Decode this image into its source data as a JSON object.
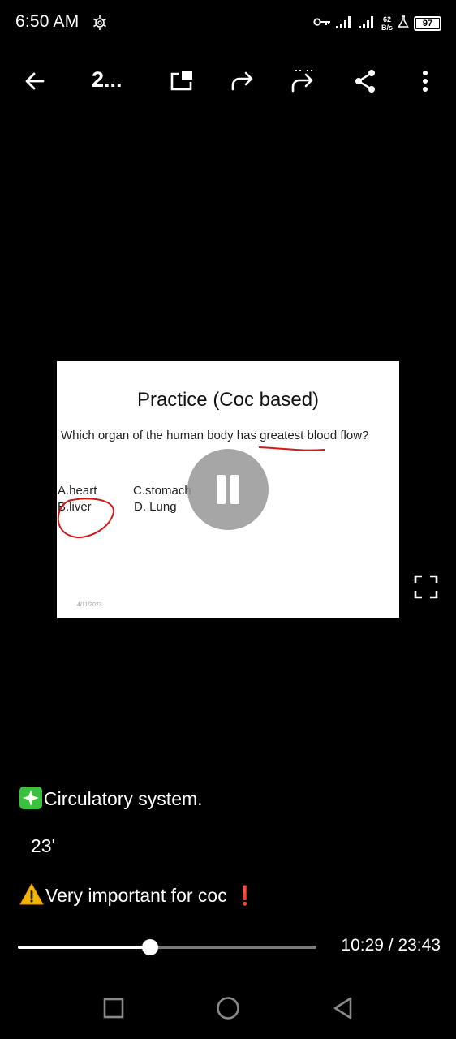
{
  "status_bar": {
    "time": "6:50 AM",
    "net_speed_value": "62",
    "net_speed_unit": "B/s",
    "battery": "97"
  },
  "toolbar": {
    "title": "2...",
    "icons": [
      "back-arrow-icon",
      "pip-icon",
      "forward-icon",
      "forward-multiple-icon",
      "share-icon",
      "more-vertical-icon"
    ]
  },
  "slide": {
    "title": "Practice (Coc based)",
    "question": "Which organ of the human body has greatest blood flow?",
    "options": {
      "a": "A.heart",
      "b": "B.liver",
      "c": "C.stomach",
      "d": "D. Lung"
    },
    "date": "4/11/2023",
    "annotation_color": "#d01a1a"
  },
  "caption": {
    "line1": "Circulatory system.",
    "line2": "23'",
    "line3": "Very important for coc",
    "line3_mark": "❗"
  },
  "player": {
    "position": "10:29",
    "duration": "23:43",
    "time_readout": "10:29 / 23:43",
    "progress_fraction": 0.442
  },
  "colors": {
    "background": "#000000",
    "track": "#7a7a7a",
    "accent_green": "#3cc03f",
    "warning_red": "#e0101a"
  }
}
